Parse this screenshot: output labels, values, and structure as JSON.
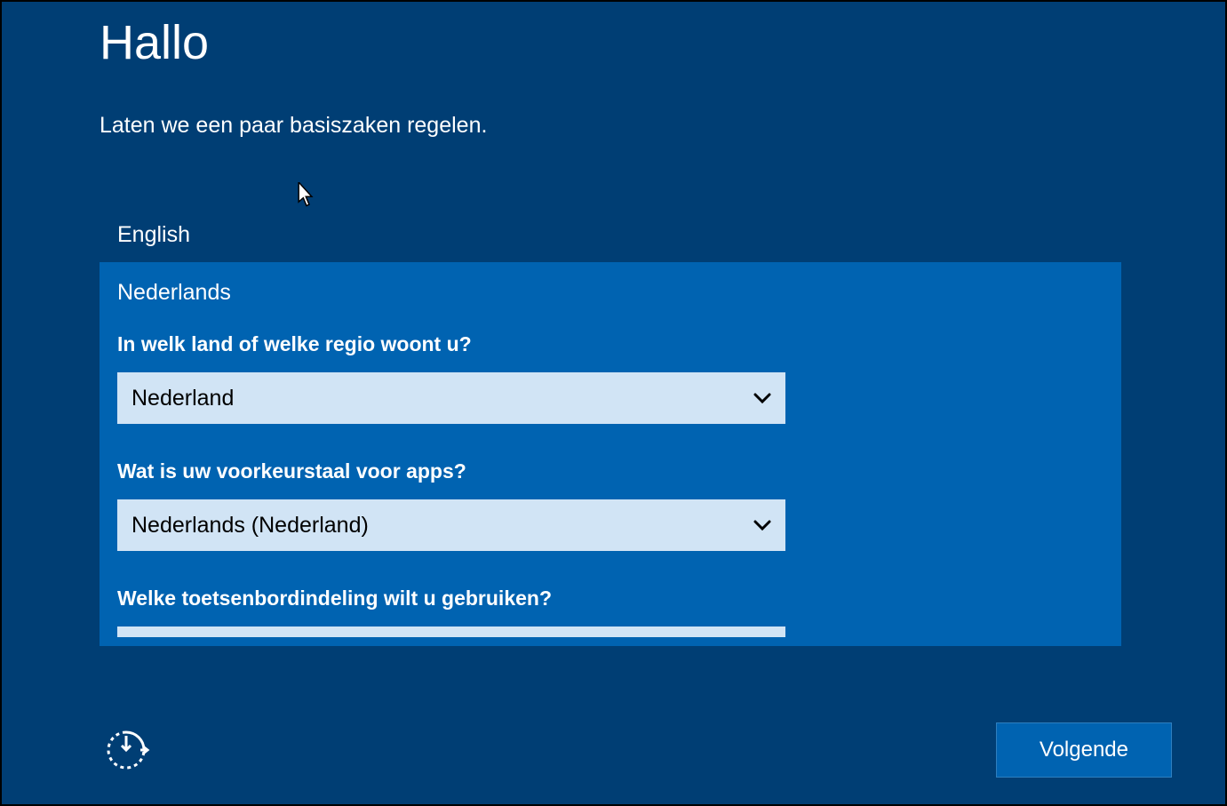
{
  "header": {
    "title": "Hallo",
    "subtitle": "Laten we een paar basiszaken regelen."
  },
  "languages": {
    "unselected_option": "English",
    "selected_option": "Nederlands"
  },
  "fields": {
    "country": {
      "label": "In welk land of welke regio woont u?",
      "value": "Nederland"
    },
    "app_language": {
      "label": "Wat is uw voorkeurstaal voor apps?",
      "value": "Nederlands (Nederland)"
    },
    "keyboard": {
      "label": "Welke toetsenbordindeling wilt u gebruiken?"
    }
  },
  "footer": {
    "next_button": "Volgende"
  },
  "colors": {
    "background": "#003e74",
    "panel": "#0063b1",
    "dropdown_bg": "#d1e4f5"
  }
}
